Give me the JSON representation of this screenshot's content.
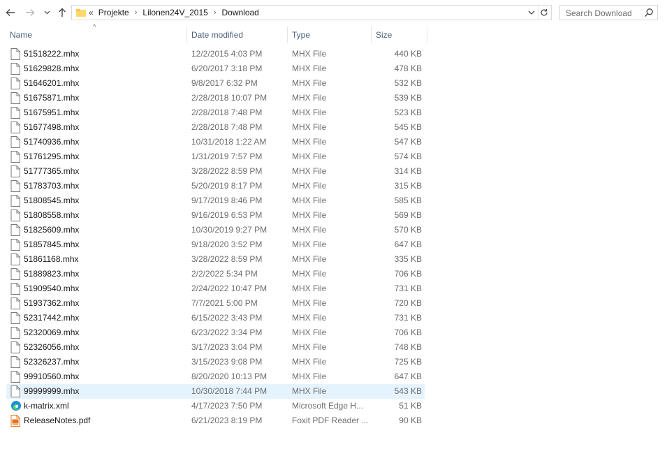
{
  "nav": {
    "back_icon": "arrow-left-icon",
    "forward_icon": "arrow-right-icon",
    "recent_icon": "chevron-down-icon",
    "up_icon": "arrow-up-icon"
  },
  "address": {
    "overflow_glyph": "«",
    "crumbs": [
      "Projekte",
      "Lilonen24V_2015",
      "Download"
    ]
  },
  "search": {
    "placeholder": "Search Download"
  },
  "columns": {
    "name": "Name",
    "date": "Date modified",
    "type": "Type",
    "size": "Size"
  },
  "files": [
    {
      "name": "51518222.mhx",
      "date": "12/2/2015 4:03 PM",
      "type": "MHX File",
      "size": "440 KB",
      "icon": "file-icon"
    },
    {
      "name": "51629828.mhx",
      "date": "6/20/2017 3:18 PM",
      "type": "MHX File",
      "size": "478 KB",
      "icon": "file-icon"
    },
    {
      "name": "51646201.mhx",
      "date": "9/8/2017 6:32 PM",
      "type": "MHX File",
      "size": "532 KB",
      "icon": "file-icon"
    },
    {
      "name": "51675871.mhx",
      "date": "2/28/2018 10:07 PM",
      "type": "MHX File",
      "size": "539 KB",
      "icon": "file-icon"
    },
    {
      "name": "51675951.mhx",
      "date": "2/28/2018 7:48 PM",
      "type": "MHX File",
      "size": "523 KB",
      "icon": "file-icon"
    },
    {
      "name": "51677498.mhx",
      "date": "2/28/2018 7:48 PM",
      "type": "MHX File",
      "size": "545 KB",
      "icon": "file-icon"
    },
    {
      "name": "51740936.mhx",
      "date": "10/31/2018 1:22 AM",
      "type": "MHX File",
      "size": "547 KB",
      "icon": "file-icon"
    },
    {
      "name": "51761295.mhx",
      "date": "1/31/2019 7:57 PM",
      "type": "MHX File",
      "size": "574 KB",
      "icon": "file-icon"
    },
    {
      "name": "51777365.mhx",
      "date": "3/28/2022 8:59 PM",
      "type": "MHX File",
      "size": "314 KB",
      "icon": "file-icon"
    },
    {
      "name": "51783703.mhx",
      "date": "5/20/2019 8:17 PM",
      "type": "MHX File",
      "size": "315 KB",
      "icon": "file-icon"
    },
    {
      "name": "51808545.mhx",
      "date": "9/17/2019 8:46 PM",
      "type": "MHX File",
      "size": "585 KB",
      "icon": "file-icon"
    },
    {
      "name": "51808558.mhx",
      "date": "9/16/2019 6:53 PM",
      "type": "MHX File",
      "size": "569 KB",
      "icon": "file-icon"
    },
    {
      "name": "51825609.mhx",
      "date": "10/30/2019 9:27 PM",
      "type": "MHX File",
      "size": "570 KB",
      "icon": "file-icon"
    },
    {
      "name": "51857845.mhx",
      "date": "9/18/2020 3:52 PM",
      "type": "MHX File",
      "size": "647 KB",
      "icon": "file-icon"
    },
    {
      "name": "51861168.mhx",
      "date": "3/28/2022 8:59 PM",
      "type": "MHX File",
      "size": "335 KB",
      "icon": "file-icon"
    },
    {
      "name": "51889823.mhx",
      "date": "2/2/2022 5:34 PM",
      "type": "MHX File",
      "size": "706 KB",
      "icon": "file-icon"
    },
    {
      "name": "51909540.mhx",
      "date": "2/24/2022 10:47 PM",
      "type": "MHX File",
      "size": "731 KB",
      "icon": "file-icon"
    },
    {
      "name": "51937362.mhx",
      "date": "7/7/2021 5:00 PM",
      "type": "MHX File",
      "size": "720 KB",
      "icon": "file-icon"
    },
    {
      "name": "52317442.mhx",
      "date": "6/15/2022 3:43 PM",
      "type": "MHX File",
      "size": "731 KB",
      "icon": "file-icon"
    },
    {
      "name": "52320069.mhx",
      "date": "6/23/2022 3:34 PM",
      "type": "MHX File",
      "size": "706 KB",
      "icon": "file-icon"
    },
    {
      "name": "52326056.mhx",
      "date": "3/17/2023 3:04 PM",
      "type": "MHX File",
      "size": "748 KB",
      "icon": "file-icon"
    },
    {
      "name": "52326237.mhx",
      "date": "3/15/2023 9:08 PM",
      "type": "MHX File",
      "size": "725 KB",
      "icon": "file-icon"
    },
    {
      "name": "99910560.mhx",
      "date": "8/20/2020 10:13 PM",
      "type": "MHX File",
      "size": "647 KB",
      "icon": "file-icon"
    },
    {
      "name": "99999999.mhx",
      "date": "10/30/2018 7:44 PM",
      "type": "MHX File",
      "size": "543 KB",
      "icon": "file-icon",
      "selected": true
    },
    {
      "name": "k-matrix.xml",
      "date": "4/17/2023 7:50 PM",
      "type": "Microsoft Edge H...",
      "size": "51 KB",
      "icon": "edge-icon"
    },
    {
      "name": "ReleaseNotes.pdf",
      "date": "6/21/2023 8:19 PM",
      "type": "Foxit PDF Reader ...",
      "size": "90 KB",
      "icon": "pdf-icon"
    }
  ],
  "colors": {
    "header_text": "#4c607a",
    "selected_row": "#e5f3ff",
    "folder": "#f5c542",
    "edge": "#1a8fd8",
    "pdf": "#e8731c"
  }
}
